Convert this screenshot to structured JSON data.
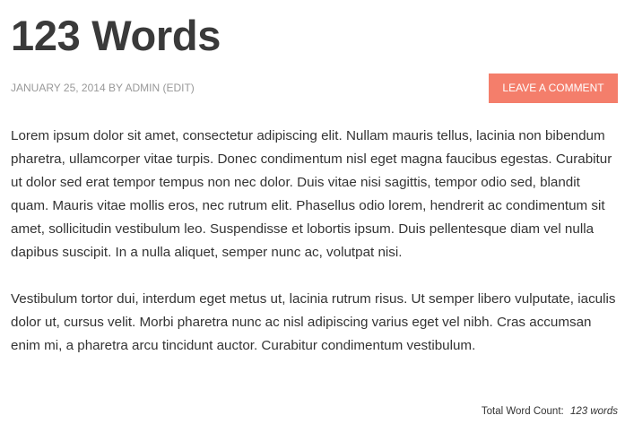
{
  "post": {
    "title": "123 Words",
    "meta": {
      "date": "January 25, 2014",
      "by": "by",
      "author": "admin",
      "edit": "(Edit)"
    },
    "leave_comment_label": "Leave a comment",
    "paragraphs": [
      "Lorem ipsum dolor sit amet, consectetur adipiscing elit. Nullam mauris tellus, lacinia non bibendum pharetra, ullamcorper vitae turpis. Donec condimentum nisl eget magna faucibus egestas. Curabitur ut dolor sed erat tempor tempus non nec dolor. Duis vitae nisi sagittis, tempor odio sed, blandit quam. Mauris vitae mollis eros, nec rutrum elit. Phasellus odio lorem, hendrerit ac condimentum sit amet, sollicitudin vestibulum leo. Suspendisse et lobortis ipsum. Duis pellentesque diam vel nulla dapibus suscipit. In a nulla aliquet, semper nunc ac, volutpat nisi.",
      "Vestibulum tortor dui, interdum eget metus ut, lacinia rutrum risus. Ut semper libero vulputate, iaculis dolor ut, cursus velit. Morbi pharetra nunc ac nisl adipiscing varius eget vel nibh. Cras accumsan enim mi, a pharetra arcu tincidunt auctor. Curabitur condimentum vestibulum."
    ],
    "word_count": {
      "label": "Total Word Count:",
      "value": "123 words"
    }
  },
  "colors": {
    "accent": "#f47e6b",
    "meta_text": "#999999",
    "body_text": "#333333",
    "title_text": "#3a3a3a"
  }
}
